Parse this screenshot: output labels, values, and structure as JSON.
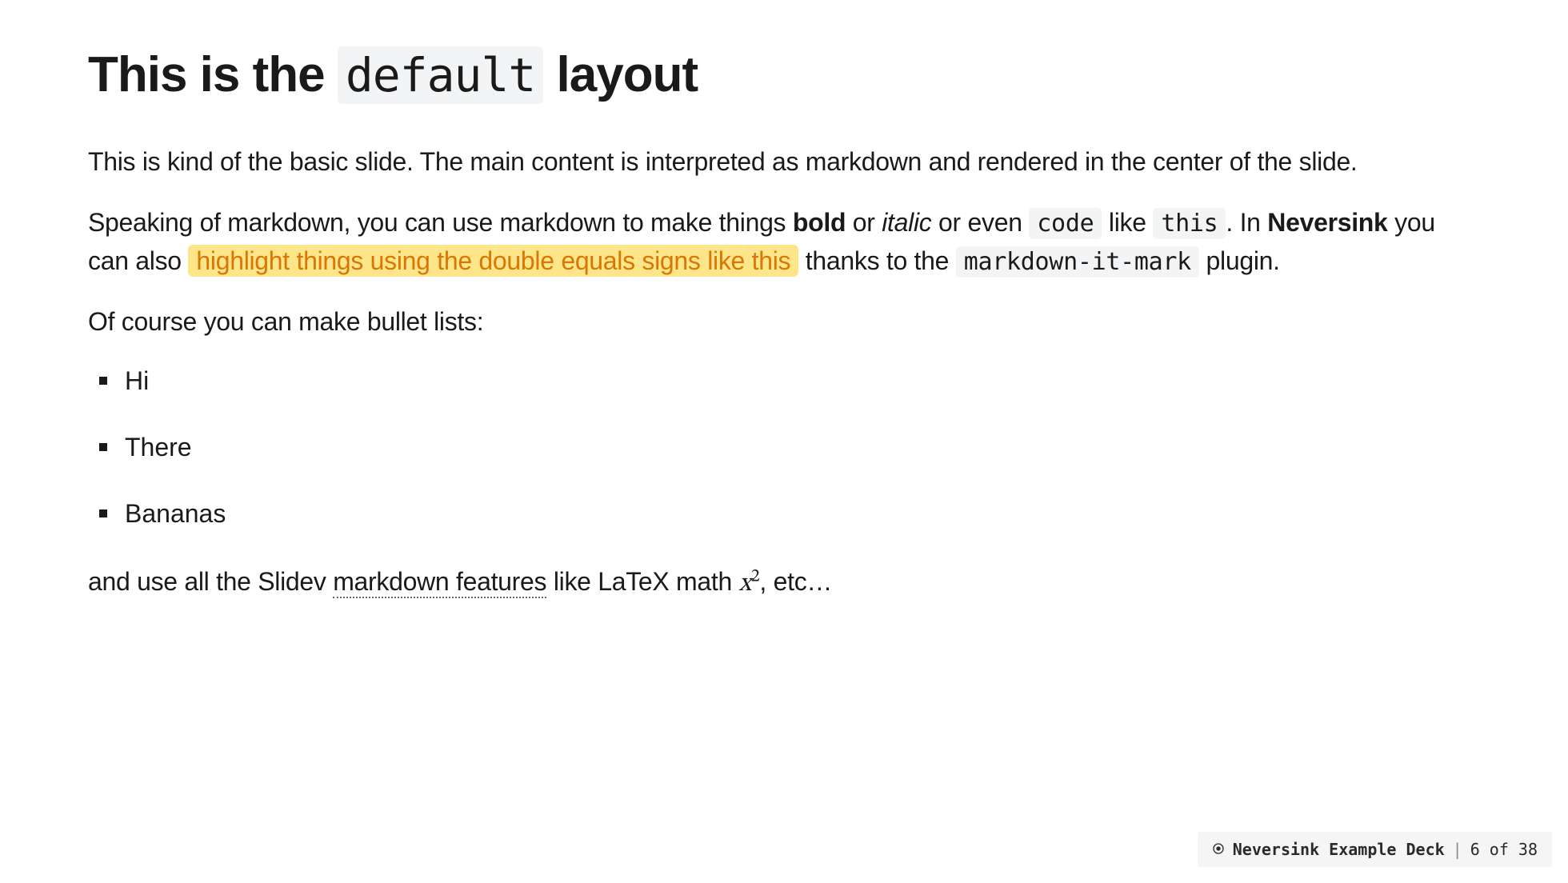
{
  "title": {
    "pre": "This is the ",
    "code": "default",
    "post": " layout"
  },
  "para1": "This is kind of the basic slide. The main content is interpreted as markdown and rendered in the center of the slide.",
  "para2": {
    "t1": "Speaking of markdown, you can use markdown to make things ",
    "bold": "bold",
    "t2": " or ",
    "italic": "italic",
    "t3": " or even ",
    "code1": "code",
    "t4": " like ",
    "code2": "this",
    "t5": ". In ",
    "brand": "Neversink",
    "t6": " you can also ",
    "mark": "highlight things using the double equals signs like this",
    "t7": " thanks to the ",
    "code3": "markdown-it-mark",
    "t8": " plugin."
  },
  "para3": "Of course you can make bullet lists:",
  "bullets": {
    "b0": "Hi",
    "b1": "There",
    "b2": "Bananas"
  },
  "para4": {
    "t1": "and use all the Slidev ",
    "link": "markdown features",
    "t2": " like LaTeX math ",
    "mathBase": "x",
    "mathSup": "2",
    "t3": ", etc…"
  },
  "footer": {
    "deck": "Neversink Example Deck",
    "sep": "|",
    "page": "6 of 38"
  }
}
